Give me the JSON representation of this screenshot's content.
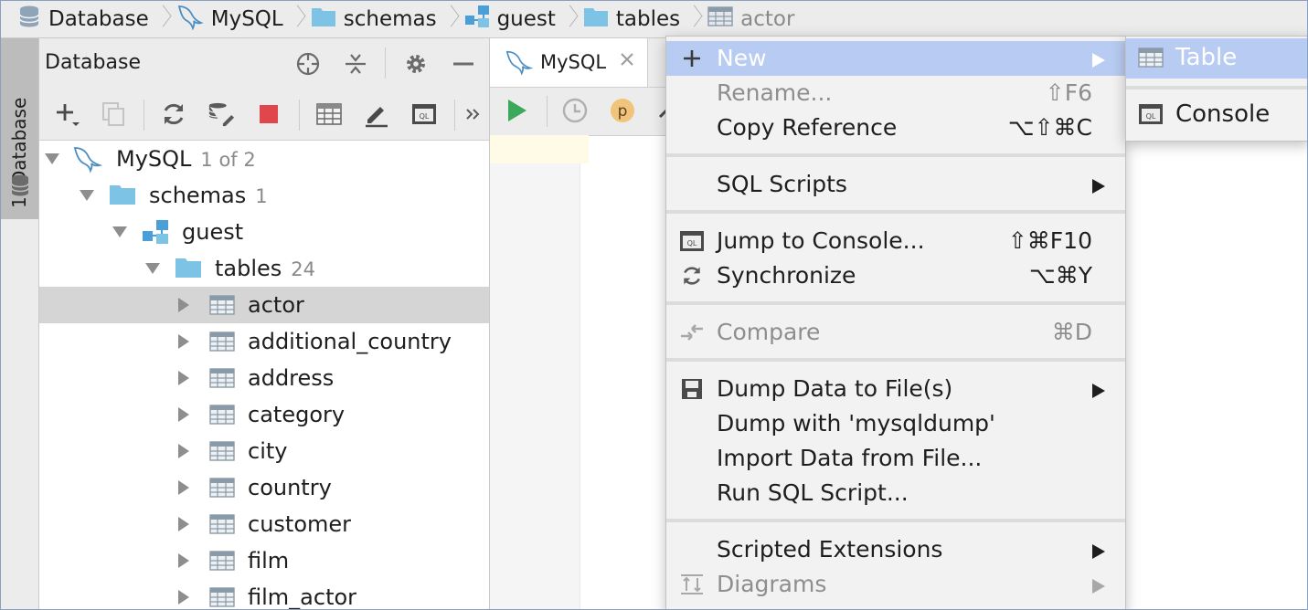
{
  "breadcrumb": {
    "items": [
      {
        "label": "Database",
        "icon": "database-icon"
      },
      {
        "label": "MySQL",
        "icon": "mysql-dolphin-icon"
      },
      {
        "label": "schemas",
        "icon": "folder-icon"
      },
      {
        "label": "guest",
        "icon": "schema-icon"
      },
      {
        "label": "tables",
        "icon": "folder-icon"
      },
      {
        "label": "actor",
        "icon": "table-icon"
      }
    ]
  },
  "toolwindow": {
    "tab_label": "1: Database"
  },
  "db_panel": {
    "title": "Database",
    "header_icons": [
      "crosshair-icon",
      "collapse-all-icon",
      "gear-icon",
      "minimize-icon"
    ],
    "toolbar_icons": [
      "add-icon",
      "duplicate-icon",
      "refresh-icon",
      "properties-icon",
      "stop-icon",
      "table-view-icon",
      "edit-icon",
      "console-icon",
      "more-icon"
    ],
    "tree": {
      "root": {
        "label": "MySQL",
        "count": "1 of 2"
      },
      "schemas": {
        "label": "schemas",
        "count": "1"
      },
      "guest": {
        "label": "guest"
      },
      "tables": {
        "label": "tables",
        "count": "24"
      },
      "items": [
        "actor",
        "additional_country",
        "address",
        "category",
        "city",
        "country",
        "customer",
        "film",
        "film_actor"
      ],
      "selected": "actor"
    }
  },
  "editor": {
    "tab_label": "MySQL",
    "toolbar_icons": [
      "run-icon",
      "history-icon",
      "p-icon"
    ]
  },
  "context_menu": {
    "new": {
      "label": "New"
    },
    "rename": {
      "label": "Rename...",
      "shortcut": "⇧F6"
    },
    "copy_reference": {
      "label": "Copy Reference",
      "shortcut": "⌥⇧⌘C"
    },
    "sql_scripts": {
      "label": "SQL Scripts"
    },
    "jump_console": {
      "label": "Jump to Console...",
      "shortcut": "⇧⌘F10"
    },
    "synchronize": {
      "label": "Synchronize",
      "shortcut": "⌥⌘Y"
    },
    "compare": {
      "label": "Compare",
      "shortcut": "⌘D"
    },
    "dump_data": {
      "label": "Dump Data to File(s)"
    },
    "dump_mysqldump": {
      "label": "Dump with 'mysqldump'"
    },
    "import_data": {
      "label": "Import Data from File..."
    },
    "run_sql": {
      "label": "Run SQL Script..."
    },
    "scripted_extensions": {
      "label": "Scripted Extensions"
    },
    "diagrams": {
      "label": "Diagrams"
    }
  },
  "submenu": {
    "table": {
      "label": "Table"
    },
    "console": {
      "label": "Console"
    }
  },
  "colors": {
    "highlight": "#b8cbf2",
    "folder": "#7cc3e6",
    "stop": "#e0474c",
    "run": "#3ca85b",
    "p_badge": "#f2c37a"
  }
}
